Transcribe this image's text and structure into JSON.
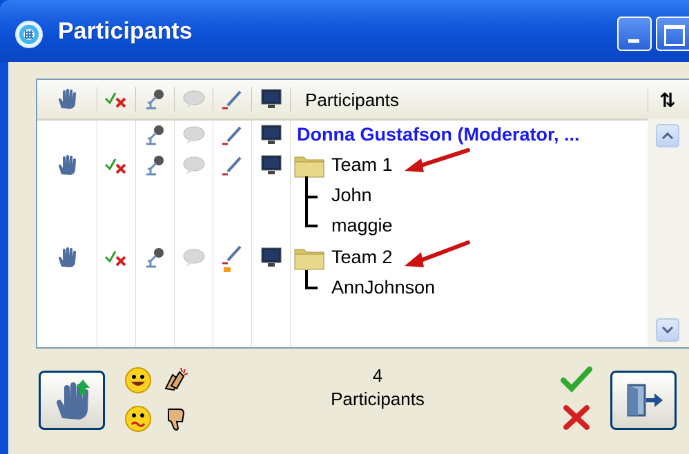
{
  "window": {
    "title": "Participants",
    "icon": "app-globe-icon"
  },
  "titlebar_buttons": [
    {
      "name": "minimize-icon"
    },
    {
      "name": "maximize-icon"
    }
  ],
  "grid": {
    "columns": [
      {
        "icon": "hand-icon"
      },
      {
        "icon": "yes-no-icon"
      },
      {
        "icon": "microphone-icon"
      },
      {
        "icon": "chat-bubble-icon"
      },
      {
        "icon": "pen-icon"
      },
      {
        "icon": "monitor-icon"
      }
    ],
    "participants_header": "Participants",
    "sort_icon": "sort-up-down-icon",
    "rows": [
      {
        "name": "Donna Gustafson (Moderator, ...",
        "type": "moderator"
      },
      {
        "name": "Team 1",
        "type": "team"
      },
      {
        "name": "John",
        "type": "member"
      },
      {
        "name": "maggie",
        "type": "member"
      },
      {
        "name": "Team 2",
        "type": "team"
      },
      {
        "name": "AnnJohnson",
        "type": "member"
      }
    ]
  },
  "footer": {
    "count": "4",
    "count_label": "Participants",
    "raise_hand_button": "raise-hand-button",
    "exit_button": "exit-door-button",
    "emoticons": [
      "smiley-icon",
      "applause-icon",
      "confused-icon",
      "thumbs-down-icon"
    ],
    "approve_icon": "green-check-icon",
    "deny_icon": "red-x-icon"
  },
  "colors": {
    "titlebar": "#0b4fd4",
    "client_bg": "#ece9d8",
    "moderator_text": "#1b1bf0",
    "annotation_arrow": "#cc1111"
  }
}
